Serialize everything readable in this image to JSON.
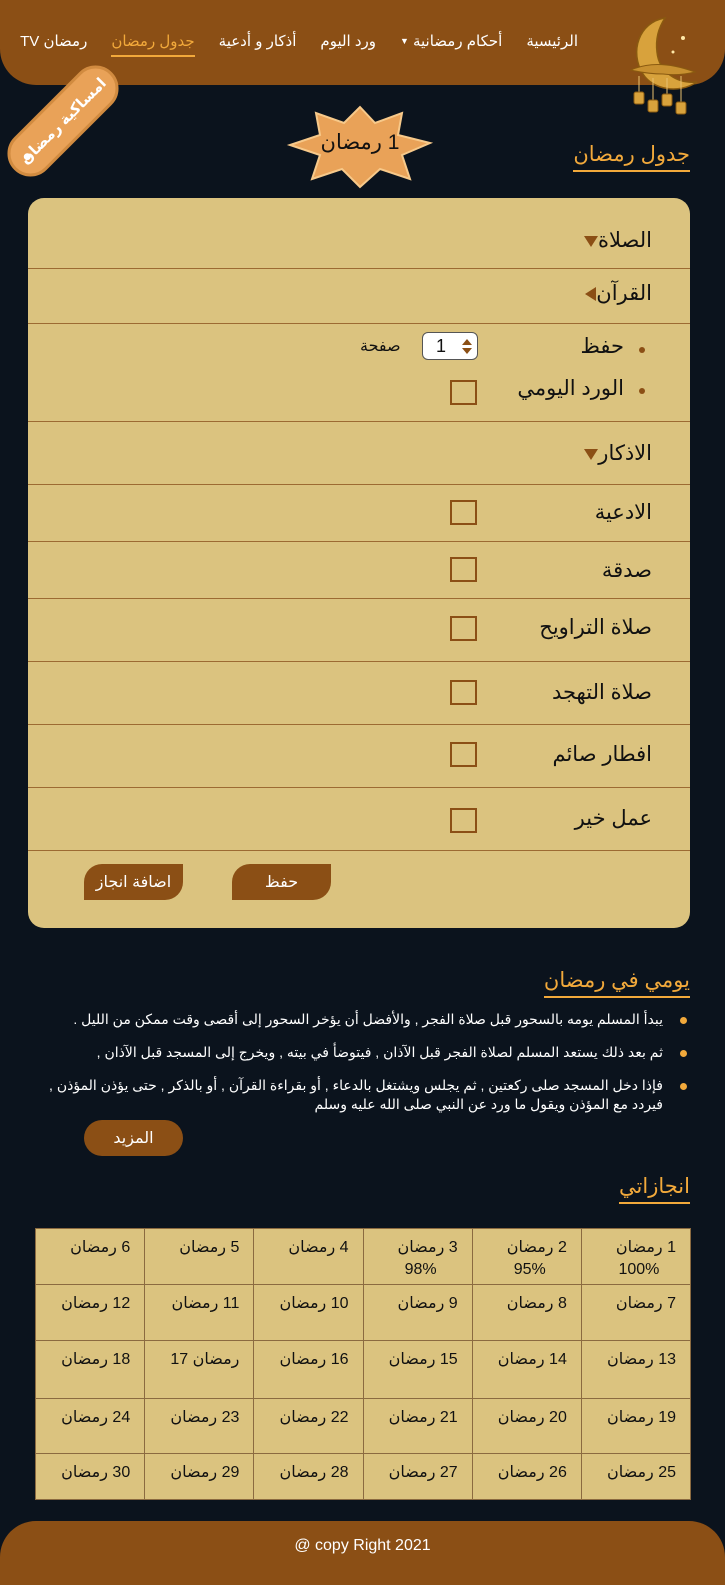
{
  "nav": {
    "items": [
      {
        "label": "الرئيسية"
      },
      {
        "label": "أحكام رمضانية"
      },
      {
        "label": "ورد اليوم"
      },
      {
        "label": "أذكار و أدعية"
      },
      {
        "label": "جدول رمضان"
      },
      {
        "label": "رمضان TV"
      }
    ],
    "active_index": 4
  },
  "ribbon": {
    "label": "امساكية رمضان"
  },
  "day_badge": {
    "label": "1 رمضان"
  },
  "schedule": {
    "title": "جدول رمضان",
    "prayer_label": "الصلاة",
    "quran_label": "القرآن",
    "quran": {
      "memorize_label": "حفظ",
      "pages_value": "1",
      "pages_unit": "صفحة",
      "daily_wird_label": "الورد اليومي"
    },
    "adhkar_label": "الاذكار",
    "tasks": [
      {
        "label": "الادعية"
      },
      {
        "label": "صدقة"
      },
      {
        "label": "صلاة التراويح"
      },
      {
        "label": "صلاة التهجد"
      },
      {
        "label": "افطار صائم"
      },
      {
        "label": "عمل خير"
      }
    ],
    "save_button": "حفظ",
    "add_button": "اضافة انجاز"
  },
  "my_day": {
    "title": "يومي في رمضان",
    "items": [
      "يبدأ المسلم يومه بالسحور قبل صلاة الفجر , والأفضل أن يؤخر السحور إلى أقصى وقت ممكن من الليل .",
      "ثم بعد ذلك يستعد المسلم لصلاة الفجر قبل الآذان , فيتوضأ في بيته , ويخرج إلى المسجد قبل الآذان ,",
      "فإذا دخل المسجد صلى ركعتين , ثم يجلس ويشتغل بالدعاء , أو بقراءة القرآن , أو بالذكر , حتى يؤذن المؤذن , فيردد مع المؤذن ويقول ما ورد عن النبي صلى الله عليه وسلم"
    ],
    "more_button": "المزيد"
  },
  "achievements": {
    "title": "انجازاتي",
    "rows": [
      [
        {
          "day": "1 رمضان",
          "pct": "100%"
        },
        {
          "day": "2 رمضان",
          "pct": "95%"
        },
        {
          "day": "3 رمضان",
          "pct": "98%"
        },
        {
          "day": "4 رمضان",
          "pct": ""
        },
        {
          "day": "5 رمضان",
          "pct": ""
        },
        {
          "day": "6 رمضان",
          "pct": ""
        }
      ],
      [
        {
          "day": "7 رمضان",
          "pct": ""
        },
        {
          "day": "8 رمضان",
          "pct": ""
        },
        {
          "day": "9 رمضان",
          "pct": ""
        },
        {
          "day": "10 رمضان",
          "pct": ""
        },
        {
          "day": "11 رمضان",
          "pct": ""
        },
        {
          "day": "12 رمضان",
          "pct": ""
        }
      ],
      [
        {
          "day": "13 رمضان",
          "pct": ""
        },
        {
          "day": "14 رمضان",
          "pct": ""
        },
        {
          "day": "15 رمضان",
          "pct": ""
        },
        {
          "day": "16 رمضان",
          "pct": ""
        },
        {
          "day": "رمضان 17",
          "pct": ""
        },
        {
          "day": "18 رمضان",
          "pct": ""
        }
      ],
      [
        {
          "day": "19 رمضان",
          "pct": ""
        },
        {
          "day": "20 رمضان",
          "pct": ""
        },
        {
          "day": "21 رمضان",
          "pct": ""
        },
        {
          "day": "22 رمضان",
          "pct": ""
        },
        {
          "day": "23 رمضان",
          "pct": ""
        },
        {
          "day": "24 رمضان",
          "pct": ""
        }
      ],
      [
        {
          "day": "25 رمضان",
          "pct": ""
        },
        {
          "day": "26 رمضان",
          "pct": ""
        },
        {
          "day": "27 رمضان",
          "pct": ""
        },
        {
          "day": "28 رمضان",
          "pct": ""
        },
        {
          "day": "29 رمضان",
          "pct": ""
        },
        {
          "day": "30 رمضان",
          "pct": ""
        }
      ]
    ]
  },
  "footer": {
    "text": "@ copy Right 2021"
  },
  "colors": {
    "brown": "#8b4f15",
    "accent": "#f2a93b",
    "card": "#dbc37f",
    "background": "#0b131d"
  },
  "icons": {
    "logo": "crescent-lantern-icon",
    "dropdown": "caret-down-icon"
  }
}
